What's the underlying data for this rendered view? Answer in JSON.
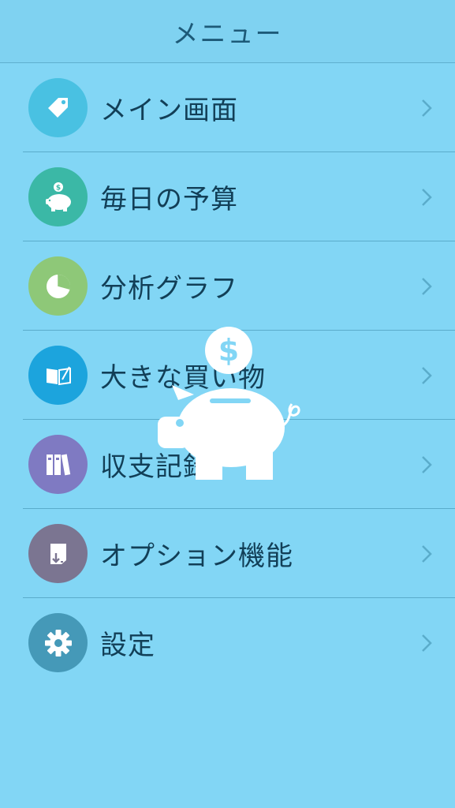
{
  "header": {
    "title": "メニュー"
  },
  "menu": {
    "items": [
      {
        "label": "メイン画面",
        "icon": "tag-icon",
        "color": "#49c1e2"
      },
      {
        "label": "毎日の予算",
        "icon": "piggy-bank-icon",
        "color": "#3bb8a6"
      },
      {
        "label": "分析グラフ",
        "icon": "pie-chart-icon",
        "color": "#8ec878"
      },
      {
        "label": "大きな買い物",
        "icon": "book-pencil-icon",
        "color": "#1ca4dd"
      },
      {
        "label": "収支記録",
        "icon": "binders-icon",
        "color": "#7f7ac2"
      },
      {
        "label": "オプション機能",
        "icon": "document-download-icon",
        "color": "#7b7591"
      },
      {
        "label": "設定",
        "icon": "gear-icon",
        "color": "#4599b8"
      }
    ]
  },
  "overlay": {
    "icon": "piggy-bank-coin-icon",
    "color": "#ffffff"
  },
  "colors": {
    "background": "#82d6f5",
    "label": "#123f57",
    "chevron": "#5aaccb"
  }
}
